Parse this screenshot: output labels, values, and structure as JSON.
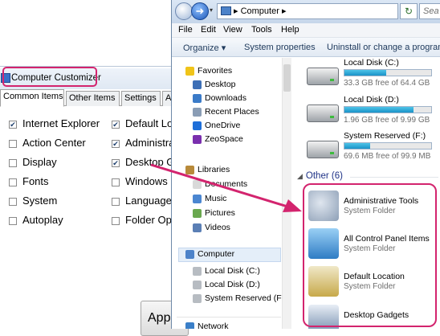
{
  "customizer": {
    "title": "Computer Customizer",
    "tabs": [
      {
        "label": "Common Items",
        "active": true
      },
      {
        "label": "Other Items",
        "active": false
      },
      {
        "label": "Settings",
        "active": false
      },
      {
        "label": "A",
        "active": false
      }
    ],
    "options": [
      {
        "label": "Internet Explorer",
        "checked": true
      },
      {
        "label": "Action Center",
        "checked": false
      },
      {
        "label": "Display",
        "checked": false
      },
      {
        "label": "Fonts",
        "checked": false
      },
      {
        "label": "System",
        "checked": false
      },
      {
        "label": "Autoplay",
        "checked": false
      },
      {
        "label": "Default Lo",
        "checked": true
      },
      {
        "label": "Administra",
        "checked": true
      },
      {
        "label": "Desktop G",
        "checked": true
      },
      {
        "label": "Windows",
        "checked": false
      },
      {
        "label": "Language",
        "checked": false
      },
      {
        "label": "Folder Op",
        "checked": false
      }
    ],
    "apply_label": "Appl"
  },
  "explorer": {
    "address": "Computer",
    "address_arrow": "▸",
    "search_placeholder": "Sea",
    "menu": [
      "File",
      "Edit",
      "View",
      "Tools",
      "Help"
    ],
    "commands": [
      "Organize ▾",
      "System properties",
      "Uninstall or change a program"
    ],
    "nav": {
      "favorites_header": "Favorites",
      "favorites": [
        "Desktop",
        "Downloads",
        "Recent Places",
        "OneDrive",
        "ZeoSpace"
      ],
      "libraries_header": "Libraries",
      "libraries": [
        "Documents",
        "Music",
        "Pictures",
        "Videos"
      ],
      "computer_header": "Computer",
      "computer_items": [
        "Local Disk (C:)",
        "Local Disk (D:)",
        "System Reserved (F:)"
      ],
      "network_header": "Network"
    },
    "drives": [
      {
        "name": "Local Disk (C:)",
        "free": "33.3 GB free of 64.4 GB",
        "used_fraction": 0.48
      },
      {
        "name": "Local Disk (D:)",
        "free": "1.96 GB free of 9.99 GB",
        "used_fraction": 0.8
      },
      {
        "name": "System Reserved (F:)",
        "free": "69.6 MB free of 99.9 MB",
        "used_fraction": 0.3
      }
    ],
    "group_header": "Other (6)",
    "other_items": [
      {
        "name": "Administrative Tools",
        "type": "System Folder"
      },
      {
        "name": "All Control Panel Items",
        "type": "System Folder"
      },
      {
        "name": "Default Location",
        "type": "System Folder"
      },
      {
        "name": "Desktop Gadgets",
        "type": ""
      }
    ]
  },
  "colors": {
    "highlight": "#d3246e",
    "link": "#1e3287",
    "drive_bar": "#26a0da"
  }
}
